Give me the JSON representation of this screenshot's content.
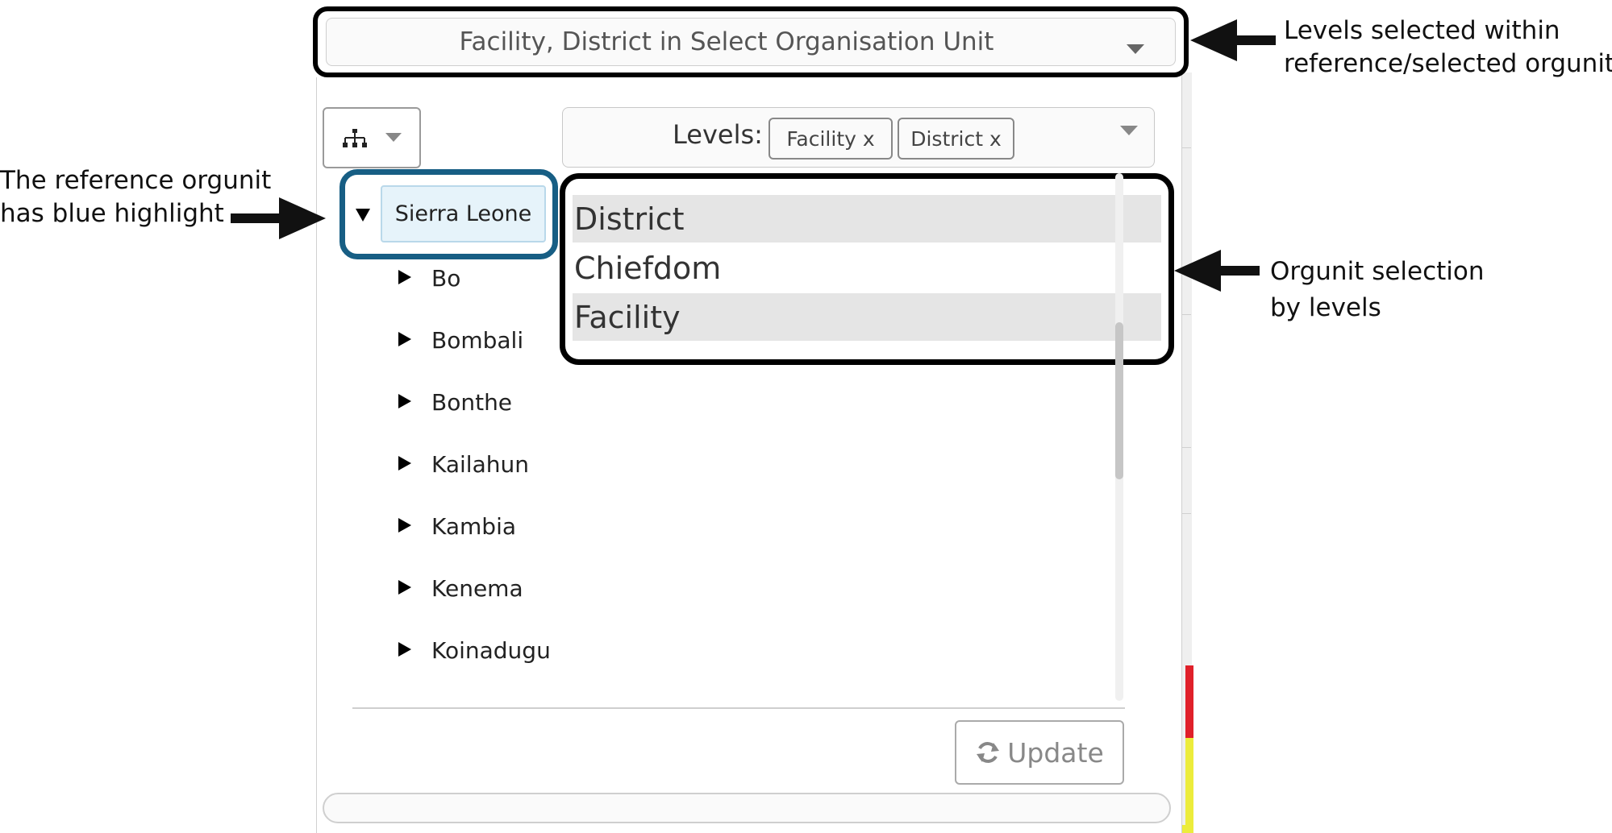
{
  "top_select": {
    "text": "Facility, District in Select Organisation Unit",
    "icon": "chevron-down-icon"
  },
  "tree_toggle": {
    "icon": "hierarchy-icon",
    "caret_icon": "chevron-down-icon"
  },
  "levels": {
    "label": "Levels:",
    "chips": [
      "Facility x",
      "District x"
    ],
    "options": [
      {
        "label": "District",
        "selected": true
      },
      {
        "label": "Chiefdom",
        "selected": false
      },
      {
        "label": "Facility",
        "selected": true
      }
    ]
  },
  "tree": {
    "root": {
      "label": "Sierra Leone",
      "expanded": true
    },
    "children": [
      "Bo",
      "Bombali",
      "Bonthe",
      "Kailahun",
      "Kambia",
      "Kenema",
      "Koinadugu"
    ]
  },
  "update_button": {
    "label": "Update",
    "icon": "refresh-icon"
  },
  "annotations": {
    "levels_selected": [
      "Levels selected within",
      "reference/selected orgunit"
    ],
    "reference_orgunit": [
      "The reference orgunit",
      "has blue highlight"
    ],
    "orgunit_selection": [
      "Orgunit selection",
      "by levels"
    ]
  },
  "colors": {
    "reference_highlight": "#e6f3fa",
    "reference_frame": "#175e84",
    "selected_option": "#e5e5e5"
  }
}
